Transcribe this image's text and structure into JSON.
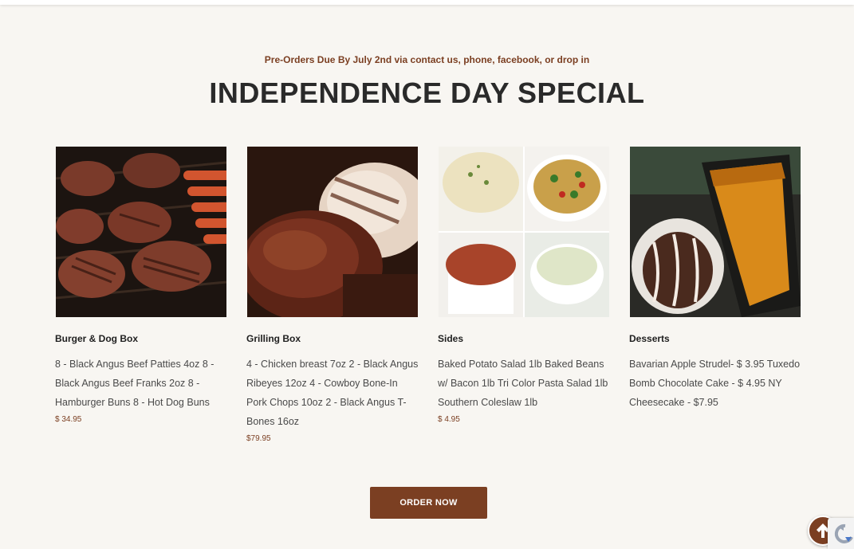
{
  "section": {
    "eyebrow": "Pre-Orders Due By July 2nd via contact us, phone, facebook, or drop in",
    "title": "INDEPENDENCE DAY SPECIAL"
  },
  "products": [
    {
      "name": "Burger & Dog Box",
      "description": "8 - Black Angus Beef Patties 4oz 8 - Black Angus Beef Franks 2oz 8 - Hamburger Buns 8 - Hot Dog Buns",
      "price": "$ 34.95"
    },
    {
      "name": "Grilling Box",
      "description": "4 - Chicken breast 7oz 2 - Black Angus Ribeyes 12oz 4 - Cowboy Bone-In Pork Chops 10oz 2 - Black Angus T-Bones 16oz",
      "price": "$79.95"
    },
    {
      "name": "Sides",
      "description": "Baked Potato Salad 1lb Baked Beans w/ Bacon 1lb Tri Color Pasta Salad 1lb Southern Coleslaw 1lb",
      "price": "$ 4.95"
    },
    {
      "name": "Desserts",
      "description": "Bavarian Apple Strudel- $ 3.95 Tuxedo Bomb Chocolate Cake - $ 4.95 NY Cheesecake - $7.95",
      "price": ""
    }
  ],
  "cta": {
    "label": "ORDER NOW"
  },
  "icons": {
    "scroll_top": "arrow-up-icon",
    "recaptcha": "recaptcha-icon"
  },
  "colors": {
    "accent": "#7b3f22",
    "background": "#f8f6f2",
    "title": "#2a2a2a"
  }
}
